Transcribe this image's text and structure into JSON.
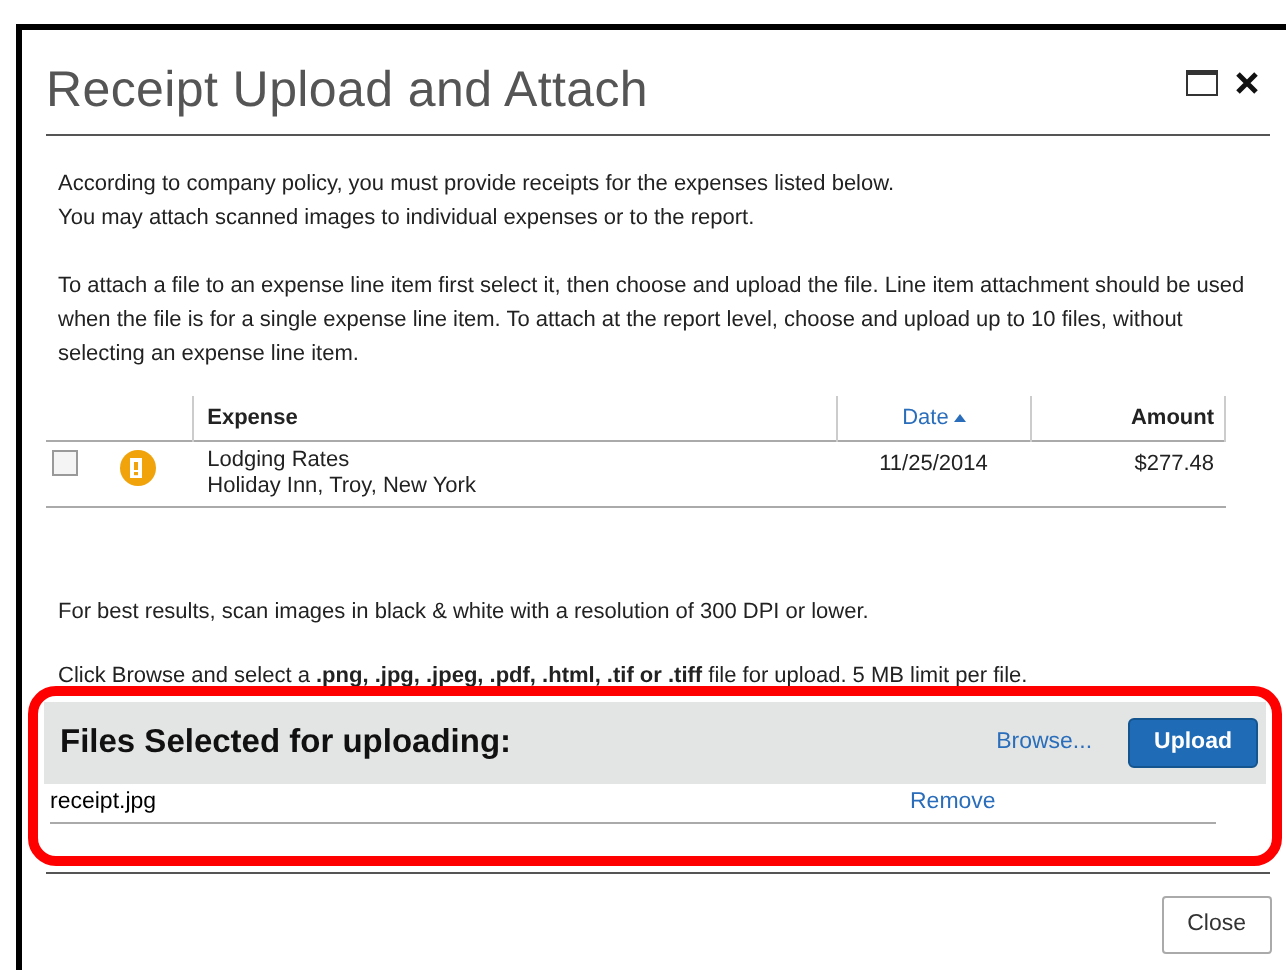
{
  "window": {
    "title": "Receipt Upload and Attach"
  },
  "intro": [
    "According to company policy, you must provide receipts for the expenses listed below.",
    "You may attach scanned images to individual expenses or to the report."
  ],
  "instructions": "To attach a file to an expense line item first select it, then choose and upload the file. Line item attachment should be used when the file is for a single expense line item. To attach at the report level, choose and upload up to 10 files, without selecting an expense line item.",
  "table": {
    "columns": [
      {
        "label": "Expense",
        "sorted": false
      },
      {
        "label": "Date",
        "sorted": true
      },
      {
        "label": "Amount",
        "sorted": false
      }
    ],
    "rows": [
      {
        "checked": false,
        "alert": true,
        "expense": "Lodging Rates",
        "location": "Holiday Inn, Troy, New York",
        "date": "11/25/2014",
        "amount": "$277.48"
      }
    ]
  },
  "tip": "For best results, scan images in black & white with a resolution of 300 DPI or lower.",
  "file_types_note": "Click Browse and select a **.png, .jpg, .jpeg, .pdf, .html, .tif or .tiff** file for upload. 5 MB limit per file.",
  "upload_panel": {
    "heading": "Files Selected for uploading:",
    "browse": "Browse...",
    "upload": "Upload",
    "files": [
      {
        "name": "receipt.jpg",
        "action": "Remove"
      }
    ]
  },
  "buttons": [
    "Close"
  ]
}
